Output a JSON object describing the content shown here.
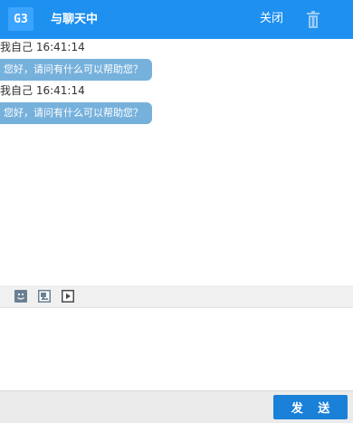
{
  "header": {
    "logo_text": "G3",
    "title": "与聊天中",
    "close_label": "关闭",
    "trash_icon": "trash-icon",
    "background": "#1e90f0"
  },
  "messages": [
    {
      "sender": "我自己",
      "time": "16:41:14",
      "text": "您好，请问有什么可以帮助您？"
    },
    {
      "sender": "我自己",
      "time": "16:41:14",
      "text": "您好，请问有什么可以帮助您？"
    }
  ],
  "toolbar": {
    "icons": [
      "emoji-icon",
      "image-icon",
      "video-icon"
    ]
  },
  "input": {
    "value": "",
    "placeholder": ""
  },
  "footer": {
    "send_label": "发 送",
    "button_color": "#1a80d8"
  },
  "colors": {
    "bubble": "#76b1dc",
    "toolbar_bg": "#f0f0f0"
  }
}
